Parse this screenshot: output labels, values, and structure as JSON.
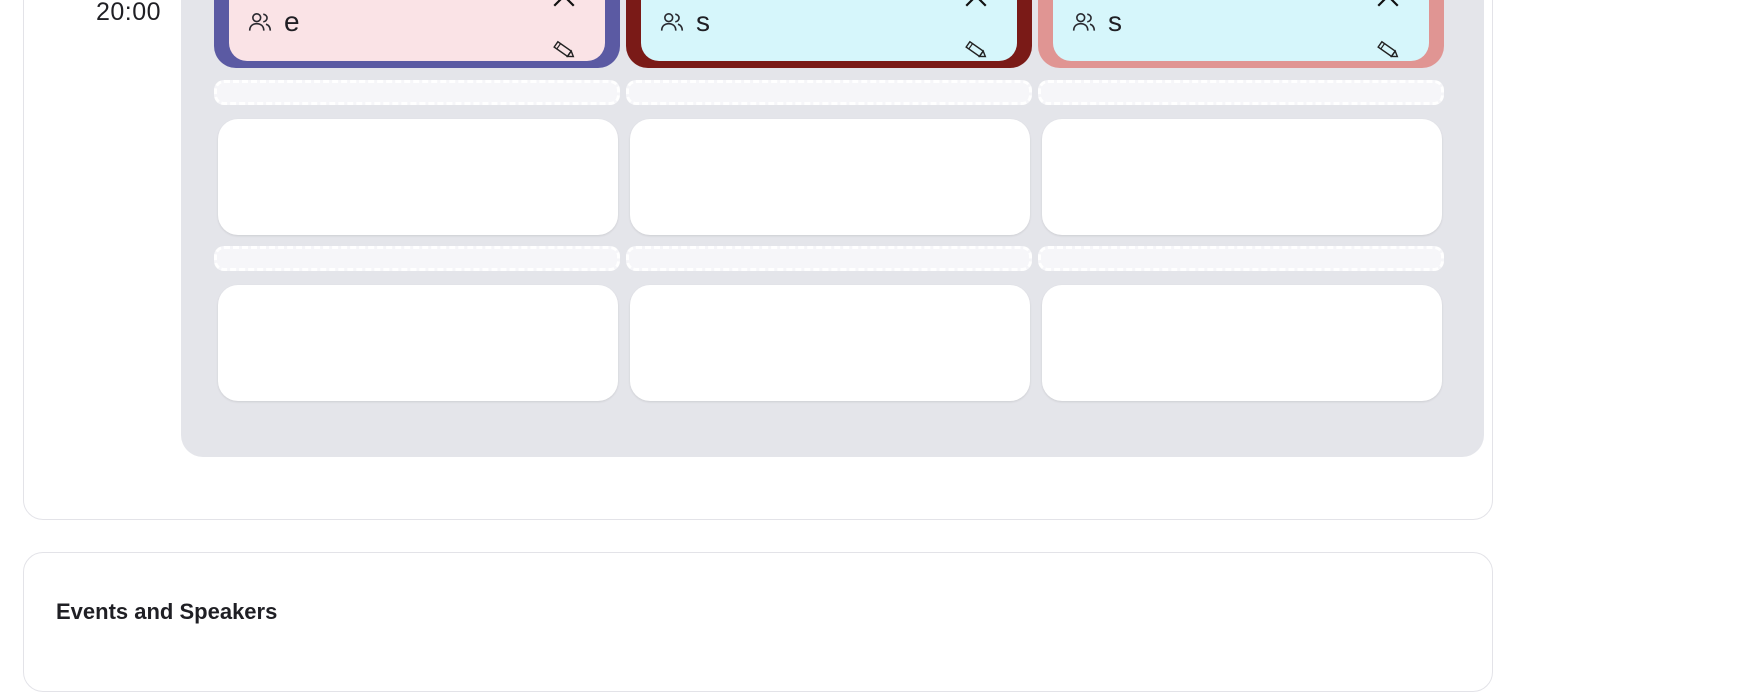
{
  "schedule": {
    "time_label": "20:00",
    "sessions": [
      {
        "name": "e",
        "border_color": "#5b5aa3",
        "fill_color": "#fae3e6"
      },
      {
        "name": "s",
        "border_color": "#7a1a17",
        "fill_color": "#d6f6fb"
      },
      {
        "name": "s",
        "border_color": "#e09593",
        "fill_color": "#d6f6fb"
      }
    ]
  },
  "events": {
    "title": "Events and Speakers"
  },
  "icons": {
    "people": "people-icon",
    "close": "close-icon",
    "edit": "pencil-icon"
  }
}
